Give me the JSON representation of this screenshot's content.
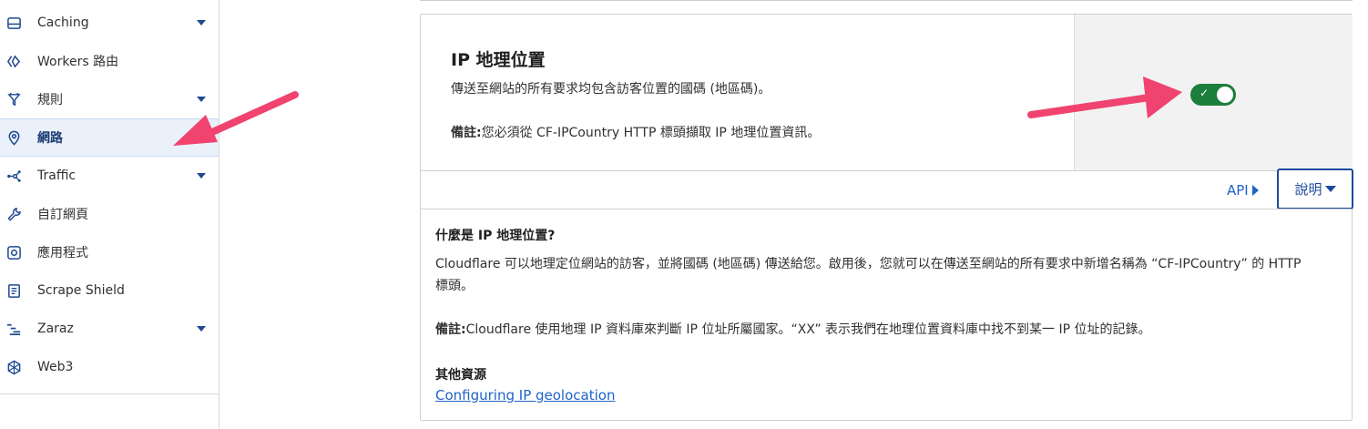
{
  "sidebar": {
    "items": [
      {
        "label": "Caching",
        "icon": "hard-drive-icon",
        "has_dropdown": true
      },
      {
        "label": "Workers 路由",
        "icon": "workers-icon",
        "has_dropdown": false
      },
      {
        "label": "規則",
        "icon": "funnel-rules-icon",
        "has_dropdown": true
      },
      {
        "label": "網路",
        "icon": "location-pin-icon",
        "has_dropdown": false,
        "active": true
      },
      {
        "label": "Traffic",
        "icon": "traffic-network-icon",
        "has_dropdown": true
      },
      {
        "label": "自訂網頁",
        "icon": "wrench-icon",
        "has_dropdown": false
      },
      {
        "label": "應用程式",
        "icon": "apps-icon",
        "has_dropdown": false
      },
      {
        "label": "Scrape Shield",
        "icon": "document-icon",
        "has_dropdown": false
      },
      {
        "label": "Zaraz",
        "icon": "zaraz-icon",
        "has_dropdown": true
      },
      {
        "label": "Web3",
        "icon": "web3-icon",
        "has_dropdown": false
      }
    ]
  },
  "card": {
    "title": "IP 地理位置",
    "description": "傳送至網站的所有要求均包含訪客位置的國碼 (地區碼)。",
    "note_label": "備註:",
    "note_text": "您必須從 CF-IPCountry HTTP 標頭擷取 IP 地理位置資訊。",
    "toggle_on": true,
    "api_label": "API",
    "help_label": "說明"
  },
  "help": {
    "heading": "什麼是 IP 地理位置?",
    "body": "Cloudflare 可以地理定位網站的訪客，並將國碼 (地區碼) 傳送給您。啟用後，您就可以在傳送至網站的所有要求中新增名稱為 “CF-IPCountry” 的 HTTP 標頭。",
    "note_label": "備註:",
    "note_text": "Cloudflare 使用地理 IP 資料庫來判斷 IP 位址所屬國家。“XX” 表示我們在地理位置資料庫中找不到某一 IP 位址的記錄。",
    "resources_heading": "其他資源",
    "resources_link": "Configuring IP geolocation"
  },
  "colors": {
    "accent_blue": "#1e63c8",
    "toggle_green": "#1b7f3b",
    "annotation_pink": "#f0436f"
  }
}
